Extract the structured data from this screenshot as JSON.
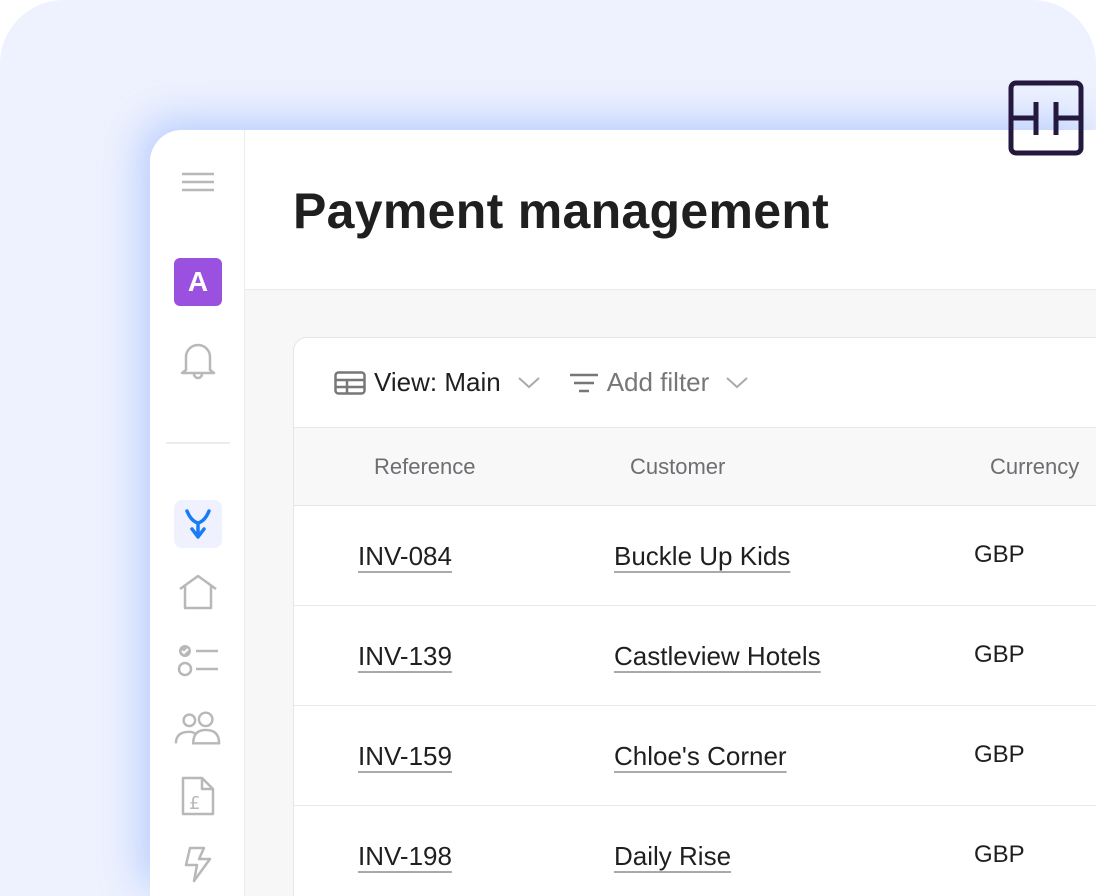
{
  "page": {
    "title": "Payment management"
  },
  "sidebar": {
    "avatar_letter": "A",
    "icons": [
      "menu-icon",
      "bell-icon",
      "merge-arrow-icon",
      "home-icon",
      "checklist-icon",
      "users-icon",
      "invoice-pound-icon",
      "lightning-icon"
    ],
    "accent": "#1a7cf5",
    "avatar_color": "#9b51e0"
  },
  "toolbar": {
    "view_label": "View: Main",
    "filter_label": "Add filter"
  },
  "table": {
    "columns": [
      "Reference",
      "Customer",
      "Currency"
    ],
    "rows": [
      {
        "reference": "INV-084",
        "customer": "Buckle Up Kids",
        "currency": "GBP"
      },
      {
        "reference": "INV-139",
        "customer": "Castleview Hotels",
        "currency": "GBP"
      },
      {
        "reference": "INV-159",
        "customer": "Chloe's Corner",
        "currency": "GBP"
      },
      {
        "reference": "INV-198",
        "customer": "Daily Rise",
        "currency": "GBP"
      }
    ]
  }
}
